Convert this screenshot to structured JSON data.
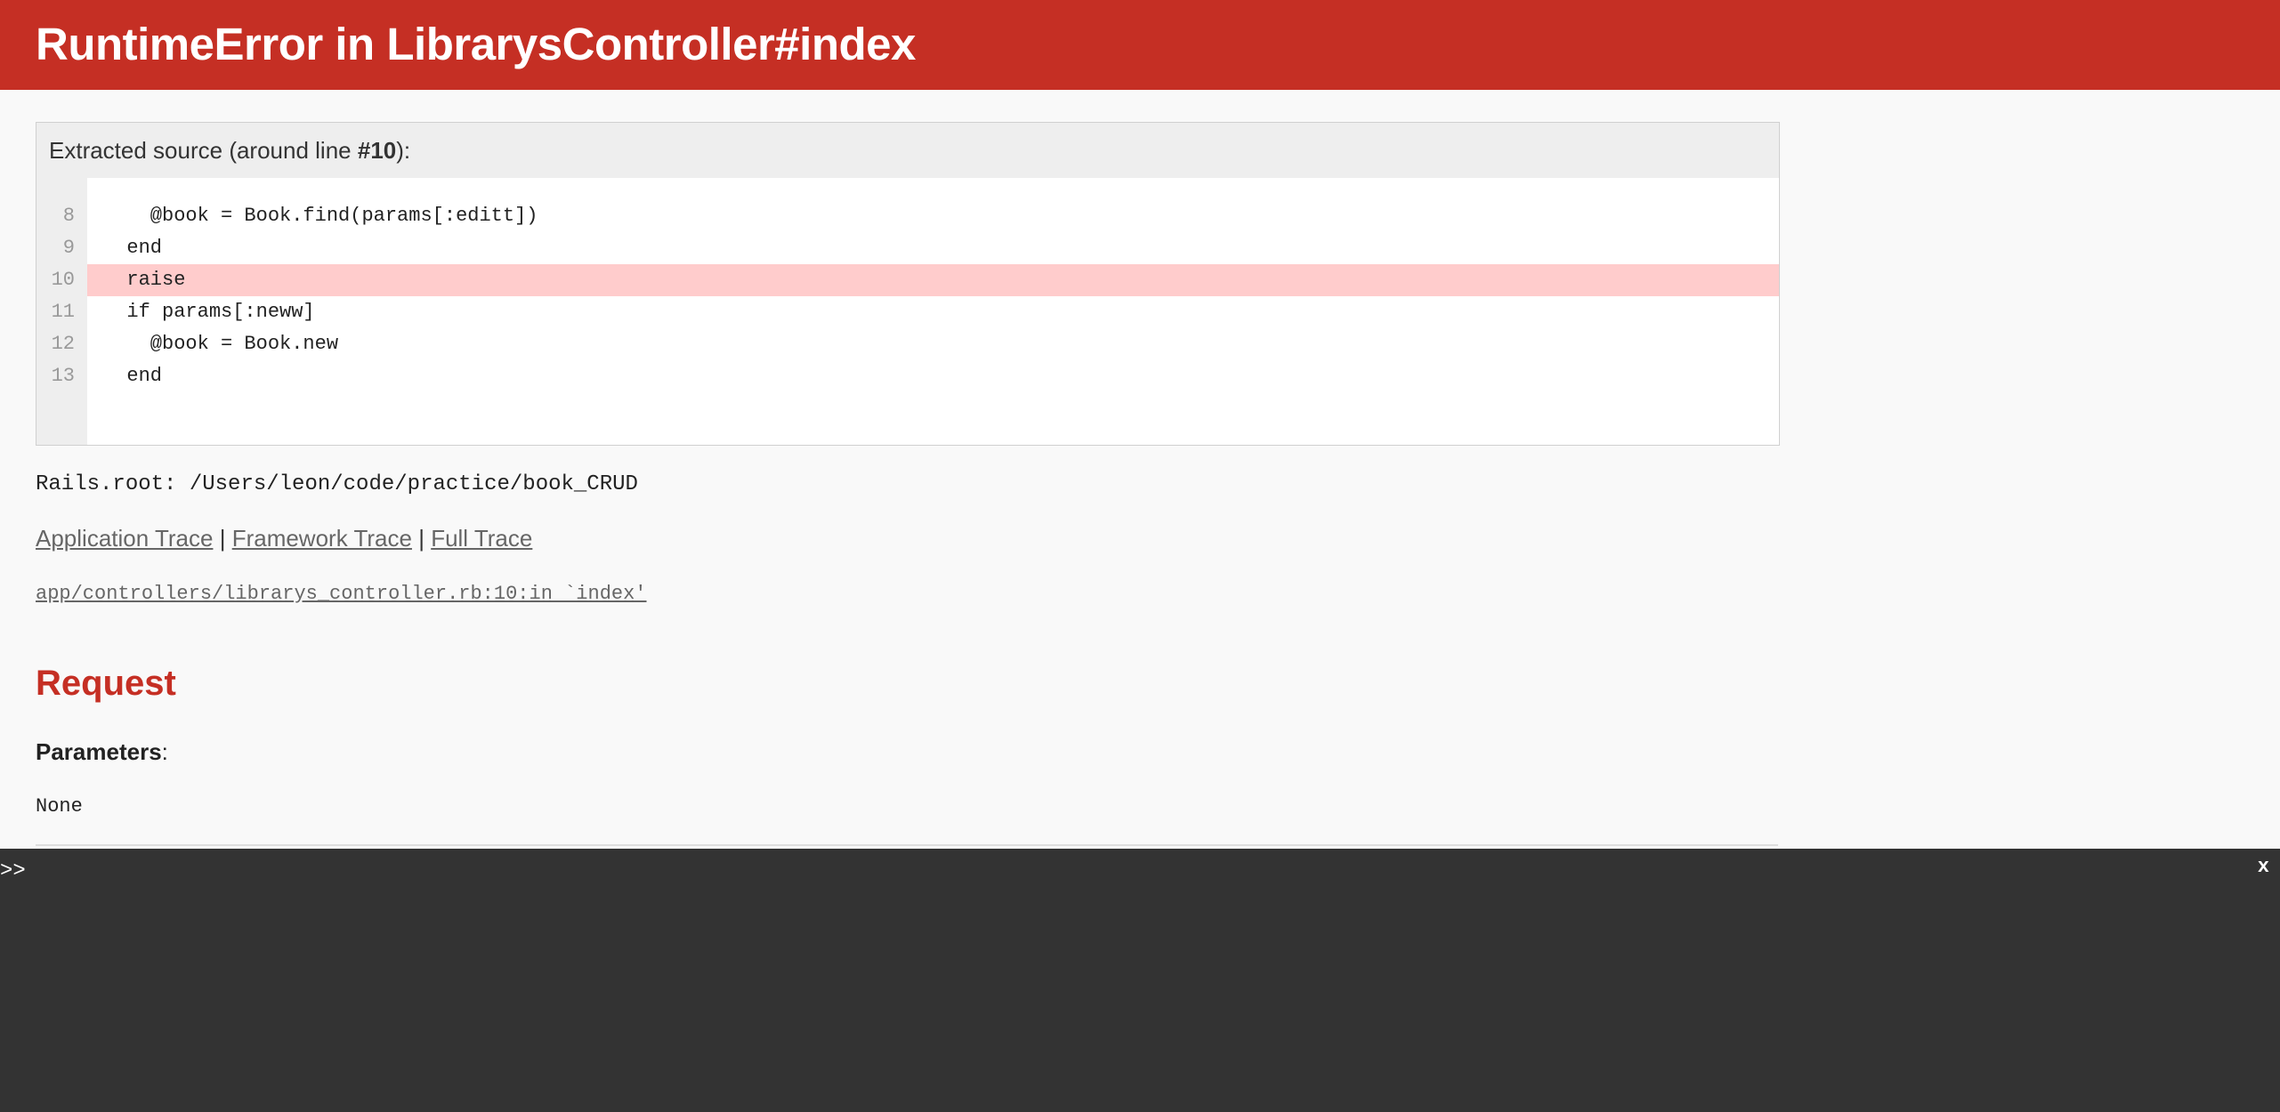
{
  "header": {
    "title": "RuntimeError in LibrarysController#index"
  },
  "source": {
    "caption_prefix": "Extracted source (around line ",
    "caption_line": "#10",
    "caption_suffix": "):",
    "highlight_line": 10,
    "lines": [
      {
        "number": "8",
        "code": "    @book = Book.find(params[:editt])"
      },
      {
        "number": "9",
        "code": "  end"
      },
      {
        "number": "10",
        "code": "  raise"
      },
      {
        "number": "11",
        "code": "  if params[:neww]"
      },
      {
        "number": "12",
        "code": "    @book = Book.new"
      },
      {
        "number": "13",
        "code": "  end"
      }
    ]
  },
  "rails_root": "Rails.root: /Users/leon/code/practice/book_CRUD",
  "traces": {
    "application": "Application Trace",
    "framework": "Framework Trace",
    "full": "Full Trace",
    "separator": "|",
    "frame": "app/controllers/librarys_controller.rb:10:in `index'"
  },
  "request": {
    "heading": "Request",
    "parameters_label": "Parameters",
    "parameters_colon": ":",
    "parameters_value": "None"
  },
  "console": {
    "prompt": ">>",
    "close": "x"
  },
  "colors": {
    "brand": "#c52f24",
    "highlight": "#ffcccc",
    "console_bg": "#333333"
  }
}
